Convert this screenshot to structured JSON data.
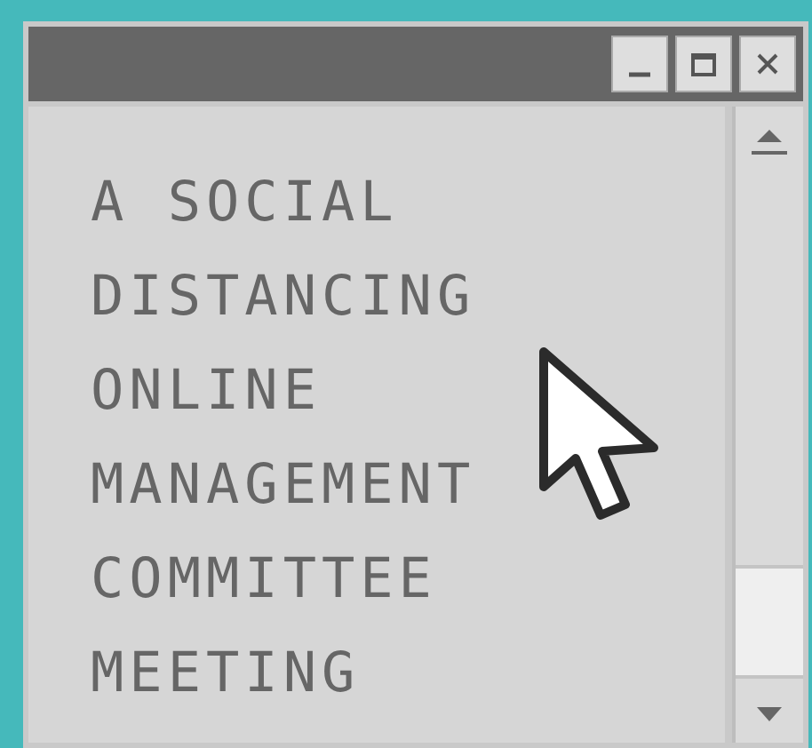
{
  "window": {
    "controls": [
      {
        "kind": "minimize"
      },
      {
        "kind": "maximize"
      },
      {
        "kind": "close"
      }
    ],
    "lines": [
      "A SOCIAL",
      "DISTANCING",
      "ONLINE",
      "MANAGEMENT",
      "COMMITTEE",
      "MEETING"
    ]
  }
}
